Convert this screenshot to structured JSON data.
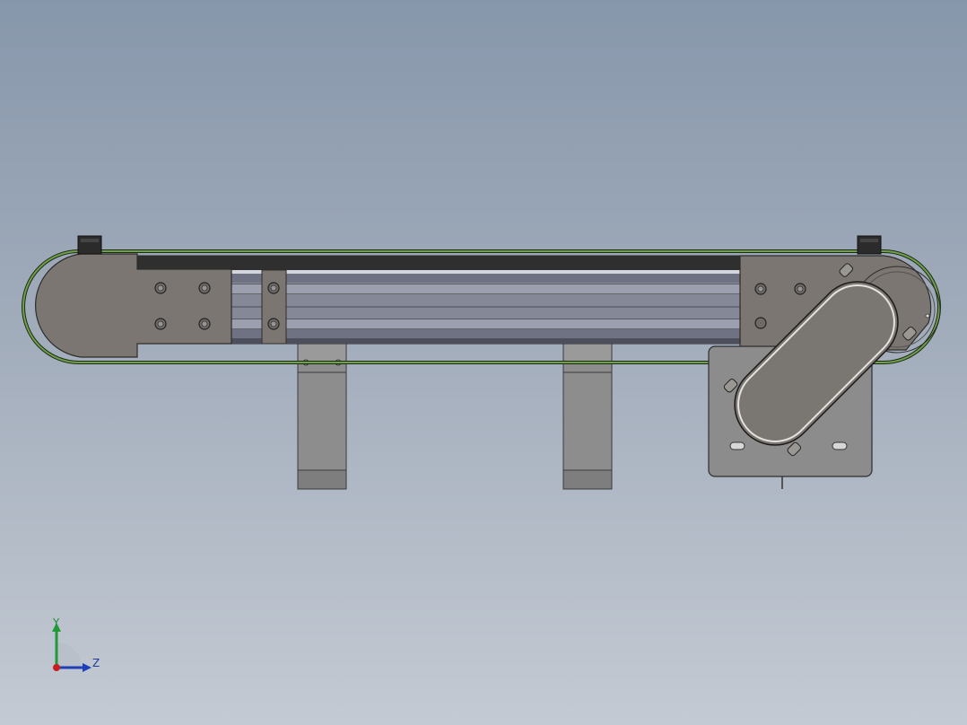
{
  "viewport": {
    "background_top": "#8797ab",
    "background_bottom": "#c4cad3"
  },
  "model": {
    "name": "belt-conveyor",
    "colors": {
      "plate": "#7b7672",
      "plate_edge": "#3a3835",
      "belt": "#6d8f4e",
      "belt_dark": "#1f1f1f",
      "rail": "#8a8d9c",
      "rail_dark": "#5f6270",
      "leg": "#8d8d8d",
      "motor_plate": "#8c8c8c",
      "gearbox": "#7a7672",
      "cap": "#2b2b2b"
    }
  },
  "triad": {
    "y_label": "Y",
    "z_label": "Z",
    "colors": {
      "y": "#1f9a36",
      "z": "#1e3fb8",
      "x": "#c8201e"
    },
    "icons": [
      "y-axis-arrow-icon",
      "z-axis-arrow-icon",
      "x-axis-dot-icon"
    ]
  }
}
